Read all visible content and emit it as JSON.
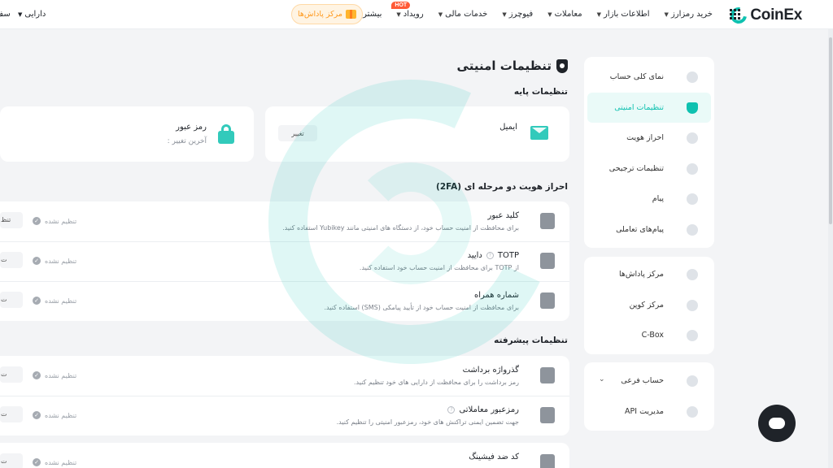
{
  "header": {
    "logo": "CoinEx",
    "nav": [
      {
        "label": "خرید رمزارز",
        "chevron": true
      },
      {
        "label": "اطلاعات بازار",
        "chevron": true
      },
      {
        "label": "معاملات",
        "chevron": true
      },
      {
        "label": "فیوچرز",
        "chevron": true
      },
      {
        "label": "خدمات مالی",
        "chevron": true
      },
      {
        "label": "رویداد",
        "chevron": true,
        "badge": "HOT"
      },
      {
        "label": "بیشتر",
        "chevron": true
      }
    ],
    "rewards_label": "مرکز پاداش‌ها",
    "assets_label": "دارایی",
    "cut_label": "سف"
  },
  "sidebar": {
    "group1": [
      {
        "label": "نمای کلی حساب",
        "icon": "overview-icon"
      },
      {
        "label": "تنظیمات امنیتی",
        "icon": "shield-icon",
        "active": true
      },
      {
        "label": "احراز هویت",
        "icon": "kyc-icon"
      },
      {
        "label": "تنظیمات ترجیحی",
        "icon": "preferences-icon"
      },
      {
        "label": "پیام",
        "icon": "message-icon"
      },
      {
        "label": "پیام‌های تعاملی",
        "icon": "interactive-message-icon"
      }
    ],
    "group2": [
      {
        "label": "مرکز پاداش‌ها",
        "icon": "gift-icon"
      },
      {
        "label": "مرکز کوپن",
        "icon": "coupon-icon"
      },
      {
        "label": "C-Box",
        "icon": "box-icon"
      }
    ],
    "group3": [
      {
        "label": "حساب فرعی",
        "icon": "sub-account-icon",
        "chevron": true
      },
      {
        "label": "مدیریت API",
        "icon": "api-icon"
      }
    ]
  },
  "main": {
    "title": "تنظیمات امنیتی",
    "basic_title": "تنظیمات پایه",
    "email": {
      "label": "ایمیل",
      "button": "تغییر"
    },
    "password": {
      "label": "رمز عبور",
      "sub": "آخرین تغییر :"
    },
    "twofa_title": "احراز هویت دو مرحله ای (2FA)",
    "twofa_rows": [
      {
        "title": "کلید عبور",
        "desc": "برای محافظت از امنیت حساب خود، از دستگاه های امنیتی مانند Yubikey استفاده کنید.",
        "status": "تنظیم نشده",
        "button": "تنظ",
        "help": false
      },
      {
        "title": "TOTP",
        "title_suffix": "دایید",
        "desc": "از TOTP برای محافظت از امنیت حساب خود استفاده کنید.",
        "status": "تنظیم نشده",
        "button": "ت",
        "help": true
      },
      {
        "title": "شماره همراه",
        "desc": "برای محافظت از امنیت حساب خود از تأیید پیامکی (SMS) استفاده کنید.",
        "status": "تنظیم نشده",
        "button": "ت",
        "help": false
      }
    ],
    "advanced_title": "تنظیمات پیشرفته",
    "advanced_rows": [
      {
        "title": "گذرواژه برداشت",
        "desc": "رمز برداشت را برای محافظت از دارایی های خود تنظیم کنید.",
        "status": "تنظیم نشده",
        "button": "ت",
        "help": false
      },
      {
        "title": "رمزعبور معاملاتی",
        "desc": "جهت تضمین ایمنی تراکنش های خود، رمزعبور امنیتی را تنظیم کنید.",
        "status": "تنظیم نشده",
        "button": "ت",
        "help": true
      },
      {
        "title": "کد ضد فیشینگ",
        "desc": "",
        "status": "تنظیم نشده",
        "button": "ت",
        "help": false
      }
    ]
  },
  "colors": {
    "accent": "#0fc1b0",
    "hot": "#ff5a36",
    "rewards": "#ff9a1f"
  }
}
